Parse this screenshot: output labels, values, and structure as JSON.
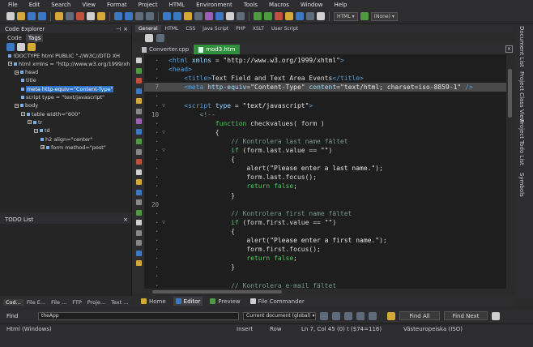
{
  "menu": [
    "File",
    "Edit",
    "Search",
    "View",
    "Format",
    "Project",
    "HTML",
    "Environment",
    "Tools",
    "Macros",
    "Window",
    "Help"
  ],
  "toolbar": {
    "combo_html": "HTML",
    "combo_none": "(None)"
  },
  "code_explorer": {
    "title": "Code Explorer",
    "pin_icon": "pin",
    "close_icon": "×",
    "tabs": [
      "Code",
      "Tags"
    ],
    "active_tab": "Tags",
    "tree": [
      {
        "text": "!DOCTYPE html PUBLIC \"-//W3C//DTD XH",
        "level": 0,
        "expander": ""
      },
      {
        "text": "html xmlns = \"http://www.w3.org/1999/xh",
        "level": 0,
        "expander": "−"
      },
      {
        "text": "head",
        "level": 1,
        "expander": "−"
      },
      {
        "text": "title",
        "level": 2,
        "expander": ""
      },
      {
        "text": "meta http-equiv=\"Content-Type\"",
        "level": 2,
        "expander": "",
        "selected": true
      },
      {
        "text": "script type = \"text/javascript\"",
        "level": 2,
        "expander": ""
      },
      {
        "text": "body",
        "level": 1,
        "expander": "−"
      },
      {
        "text": "table width=\"600\"",
        "level": 2,
        "expander": "−"
      },
      {
        "text": "tr",
        "level": 3,
        "expander": "−"
      },
      {
        "text": "td",
        "level": 4,
        "expander": "−"
      },
      {
        "text": "h2 align=\"center\"",
        "level": 5,
        "expander": ""
      },
      {
        "text": "form method=\"post\"",
        "level": 5,
        "expander": "+"
      }
    ]
  },
  "todo": {
    "title": "TODO List",
    "close_icon": "×"
  },
  "left_tabs": [
    "Cod...",
    "File E...",
    "File ...",
    "FTP",
    "Proje...",
    "Text ..."
  ],
  "lang_tabs": [
    "General",
    "HTML",
    "CSS",
    "Java Script",
    "PHP",
    "XSLT",
    "User Script"
  ],
  "active_lang_tab": "General",
  "doc_tabs": [
    {
      "label": "Converter.cpp",
      "active": false
    },
    {
      "label": "mod3.htm",
      "active": true
    }
  ],
  "doc_close": "×",
  "editor": {
    "lines": [
      {
        "num": "",
        "fold": "",
        "code": "<html xmlns = \"http://www.w3.org/1999/xhtml\">"
      },
      {
        "num": "",
        "fold": "",
        "code": "<head>"
      },
      {
        "num": "",
        "fold": "",
        "code": "    <title>Text Field and Text Area Events</title>"
      },
      {
        "num": "7",
        "fold": "",
        "code": "    <meta http-equiv=\"Content-Type\" content=\"text/html; charset=iso-8859-1\" />",
        "highlight": true
      },
      {
        "num": "",
        "fold": "",
        "code": ""
      },
      {
        "num": "",
        "fold": "▽",
        "code": "    <script type = \"text/javascript\">"
      },
      {
        "num": "10",
        "fold": "",
        "code": "        <!--"
      },
      {
        "num": "",
        "fold": "",
        "code": "            function checkvalues( form )"
      },
      {
        "num": "",
        "fold": "▽",
        "code": "            {"
      },
      {
        "num": "",
        "fold": "",
        "code": "                // Kontrolera last name fältet"
      },
      {
        "num": "",
        "fold": "▽",
        "code": "                if (form.last.value == \"\")"
      },
      {
        "num": "",
        "fold": "",
        "code": "                {"
      },
      {
        "num": "",
        "fold": "",
        "code": "                    alert(\"Please enter a last name.\");"
      },
      {
        "num": "",
        "fold": "",
        "code": "                    form.last.focus();"
      },
      {
        "num": "",
        "fold": "",
        "code": "                    return false;"
      },
      {
        "num": "",
        "fold": "",
        "code": "                }"
      },
      {
        "num": "20",
        "fold": "",
        "code": ""
      },
      {
        "num": "",
        "fold": "",
        "code": "                // Kontrolera first name fältet"
      },
      {
        "num": "",
        "fold": "▽",
        "code": "                if (form.first.value == \"\")"
      },
      {
        "num": "",
        "fold": "",
        "code": "                {"
      },
      {
        "num": "",
        "fold": "",
        "code": "                    alert(\"Please enter a first name.\");"
      },
      {
        "num": "",
        "fold": "",
        "code": "                    form.first.focus();"
      },
      {
        "num": "",
        "fold": "",
        "code": "                    return false;"
      },
      {
        "num": "",
        "fold": "",
        "code": "                }"
      },
      {
        "num": "",
        "fold": "",
        "code": ""
      },
      {
        "num": "",
        "fold": "",
        "code": "                // Kontrolera e-mail fältet"
      }
    ]
  },
  "right_dock": [
    "Document List",
    "Project Class View",
    "Project Todo List",
    "Symbols"
  ],
  "view_tabs": [
    {
      "label": "Home",
      "active": false
    },
    {
      "label": "Editor",
      "active": true
    },
    {
      "label": "Preview",
      "active": false
    },
    {
      "label": "File Commander",
      "active": false
    }
  ],
  "findbar": {
    "label": "Find",
    "search_value": "theApp",
    "scope": "Current document (global)",
    "find_all": "Find All",
    "find_next": "Find Next"
  },
  "status": {
    "mode": "Html (Windows)",
    "insert": "Insert",
    "row": "Row",
    "position": "Ln 7, Col 45 (0) t ($74=116)",
    "encoding": "Västeuropeiska (ISO)"
  },
  "colors": {
    "tag": "#569cd6",
    "attr": "#9cdcfe",
    "string": "#e5e5e5",
    "comment": "#7a9a8a",
    "keyword": "#4ec95f",
    "accent_tab": "#2f8f3a",
    "selection": "#2b6fc4"
  }
}
